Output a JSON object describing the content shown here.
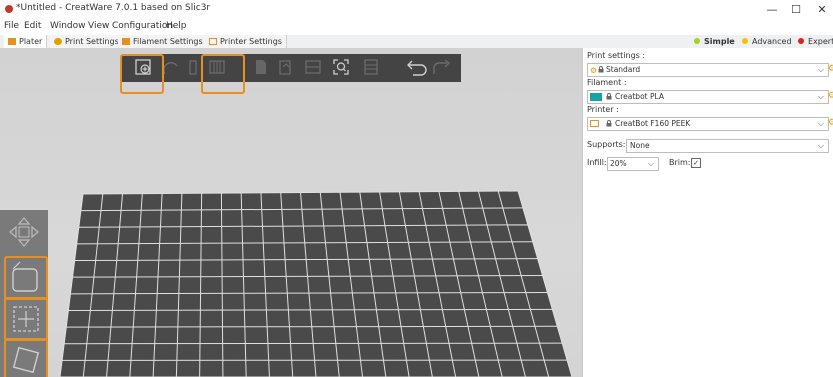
{
  "window": {
    "title": "*Untitled - CreatWare 7.0.1 based on Slic3r",
    "minimize": "—",
    "maximize": "☐",
    "close": "✕"
  },
  "menu": [
    "File",
    "Edit",
    "Window",
    "View",
    "Configuration",
    "Help"
  ],
  "tabs": [
    {
      "label": "Plater",
      "color": "#e8901f"
    },
    {
      "label": "Print Settings",
      "color": "#e0a000"
    },
    {
      "label": "Filament Settings",
      "color": "#e8901f"
    },
    {
      "label": "Printer Settings",
      "color": "#e8901f"
    }
  ],
  "modes": [
    {
      "label": "Simple",
      "color": "#a6d11b"
    },
    {
      "label": "Advanced",
      "color": "#f5c400"
    },
    {
      "label": "Expert",
      "color": "#e02020"
    }
  ],
  "toolbar": {
    "icons": [
      "add-icon",
      "delete-icon",
      "delete-all-icon",
      "arrange-icon",
      "copy-icon",
      "paste-icon",
      "add-instance-icon",
      "remove-instance-icon",
      "split-icon",
      "layers-icon",
      "undo-icon",
      "redo-icon"
    ],
    "highlight_color": "#e8901f"
  },
  "panel": {
    "print_settings_label": "Print settings :",
    "print_settings_value": "Standard",
    "filament_label": "Filament :",
    "filament_value": "Creatbot PLA",
    "filament_color": "#1aa1a6",
    "printer_label": "Printer :",
    "printer_value": "CreatBot F160 PEEK",
    "supports_label": "Supports:",
    "supports_value": "None",
    "infill_label": "Infill:",
    "infill_value": "20%",
    "brim_label": "Brim:",
    "brim_checked": true
  },
  "viewport": {
    "bed_color": "#4a4a4a",
    "background": "#d4d4d4"
  }
}
